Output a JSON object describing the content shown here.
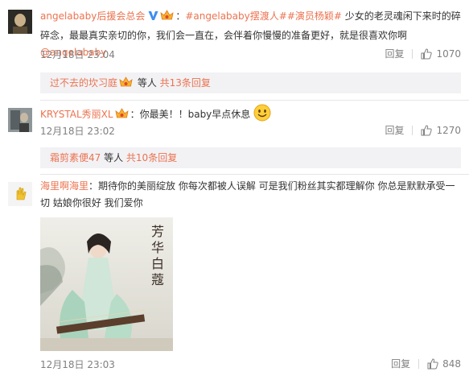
{
  "comments": [
    {
      "user": "angelababy后援会总会",
      "text_pre": "：",
      "tag1": "#angelababy摆渡人#",
      "tag2": "#演员杨颖#",
      "text_body": " 少女的老灵魂闲下来时的碎碎念，最最真实亲切的你，我们会一直在，会伴着你慢慢的准备更好，就是很喜欢你啊",
      "mention": "@angelababy",
      "time": "12月18日 23:04",
      "reply_label": "回复",
      "likes": "1070",
      "sub": {
        "user": "过不去的坎习庭",
        "suffix": " 等人 ",
        "count_link": "共13条回复"
      }
    },
    {
      "user": "KRYSTAL秀丽XL",
      "text_body": "：你最美！！baby早点休息",
      "time": "12月18日 23:02",
      "reply_label": "回复",
      "likes": "1270",
      "sub": {
        "user": "霜剪素便47",
        "suffix": " 等人 ",
        "count_link": "共10条回复"
      }
    },
    {
      "user": "海里啊海里",
      "text_body": "：期待你的美丽绽放 你每次都被人误解 可是我们粉丝其实都理解你 你总是默默承受一切 姑娘你很好 我们爱你",
      "time": "12月18日 23:03",
      "reply_label": "回复",
      "likes": "848"
    }
  ],
  "poster_text": "芳华白蔻",
  "colors": {
    "link": "#eb7350",
    "meta": "#808080",
    "sub_bg": "#f2f2f5",
    "vbadge": "#3d8ef0"
  }
}
